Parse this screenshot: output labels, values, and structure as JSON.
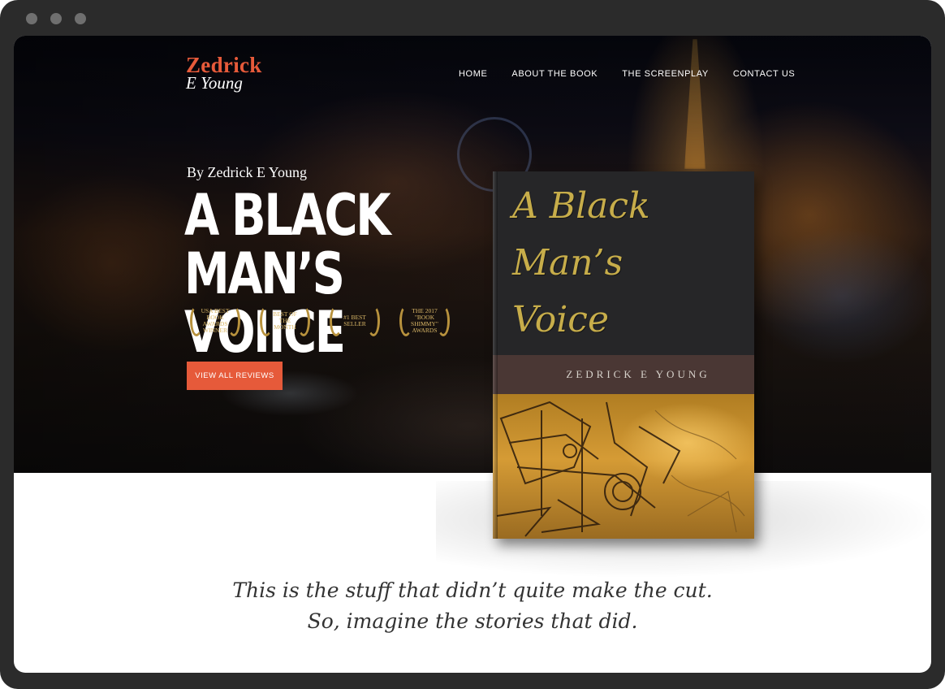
{
  "logo": {
    "name": "Zedrick",
    "sub": "E Young"
  },
  "nav": {
    "items": [
      {
        "label": "HOME"
      },
      {
        "label": "ABOUT THE BOOK"
      },
      {
        "label": "THE SCREENPLAY"
      },
      {
        "label": "CONTACT US"
      }
    ]
  },
  "hero": {
    "byline": "By Zedrick E Young",
    "headline_line1": "A BLACK",
    "headline_line2": "MAN’S VOIICE",
    "awards": [
      {
        "text": "USA BEST BOOK AWARDS WINNER"
      },
      {
        "text": "BEST OF THE MONTH"
      },
      {
        "text": "#1 BEST SELLER"
      },
      {
        "text": "THE 2017 \"book shimmy\" AWARDS"
      }
    ],
    "cta_label": "VIEW ALL REVIEWS"
  },
  "book": {
    "title": "A Black\nMan’s\nVoice",
    "author": "ZEDRICK E YOUNG"
  },
  "quote": {
    "line1": "This is the stuff that didn’t quite make the cut.",
    "line2": "So, imagine the stories that did."
  },
  "colors": {
    "accent": "#e65a3a",
    "gold": "#c7ad4a"
  }
}
